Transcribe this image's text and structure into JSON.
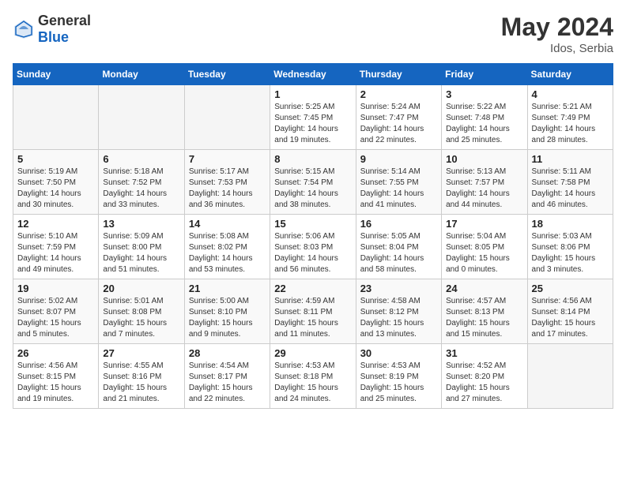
{
  "header": {
    "logo_general": "General",
    "logo_blue": "Blue",
    "month_year": "May 2024",
    "location": "Idos, Serbia"
  },
  "days_of_week": [
    "Sunday",
    "Monday",
    "Tuesday",
    "Wednesday",
    "Thursday",
    "Friday",
    "Saturday"
  ],
  "weeks": [
    [
      {
        "day": "",
        "info": ""
      },
      {
        "day": "",
        "info": ""
      },
      {
        "day": "",
        "info": ""
      },
      {
        "day": "1",
        "info": "Sunrise: 5:25 AM\nSunset: 7:45 PM\nDaylight: 14 hours\nand 19 minutes."
      },
      {
        "day": "2",
        "info": "Sunrise: 5:24 AM\nSunset: 7:47 PM\nDaylight: 14 hours\nand 22 minutes."
      },
      {
        "day": "3",
        "info": "Sunrise: 5:22 AM\nSunset: 7:48 PM\nDaylight: 14 hours\nand 25 minutes."
      },
      {
        "day": "4",
        "info": "Sunrise: 5:21 AM\nSunset: 7:49 PM\nDaylight: 14 hours\nand 28 minutes."
      }
    ],
    [
      {
        "day": "5",
        "info": "Sunrise: 5:19 AM\nSunset: 7:50 PM\nDaylight: 14 hours\nand 30 minutes."
      },
      {
        "day": "6",
        "info": "Sunrise: 5:18 AM\nSunset: 7:52 PM\nDaylight: 14 hours\nand 33 minutes."
      },
      {
        "day": "7",
        "info": "Sunrise: 5:17 AM\nSunset: 7:53 PM\nDaylight: 14 hours\nand 36 minutes."
      },
      {
        "day": "8",
        "info": "Sunrise: 5:15 AM\nSunset: 7:54 PM\nDaylight: 14 hours\nand 38 minutes."
      },
      {
        "day": "9",
        "info": "Sunrise: 5:14 AM\nSunset: 7:55 PM\nDaylight: 14 hours\nand 41 minutes."
      },
      {
        "day": "10",
        "info": "Sunrise: 5:13 AM\nSunset: 7:57 PM\nDaylight: 14 hours\nand 44 minutes."
      },
      {
        "day": "11",
        "info": "Sunrise: 5:11 AM\nSunset: 7:58 PM\nDaylight: 14 hours\nand 46 minutes."
      }
    ],
    [
      {
        "day": "12",
        "info": "Sunrise: 5:10 AM\nSunset: 7:59 PM\nDaylight: 14 hours\nand 49 minutes."
      },
      {
        "day": "13",
        "info": "Sunrise: 5:09 AM\nSunset: 8:00 PM\nDaylight: 14 hours\nand 51 minutes."
      },
      {
        "day": "14",
        "info": "Sunrise: 5:08 AM\nSunset: 8:02 PM\nDaylight: 14 hours\nand 53 minutes."
      },
      {
        "day": "15",
        "info": "Sunrise: 5:06 AM\nSunset: 8:03 PM\nDaylight: 14 hours\nand 56 minutes."
      },
      {
        "day": "16",
        "info": "Sunrise: 5:05 AM\nSunset: 8:04 PM\nDaylight: 14 hours\nand 58 minutes."
      },
      {
        "day": "17",
        "info": "Sunrise: 5:04 AM\nSunset: 8:05 PM\nDaylight: 15 hours\nand 0 minutes."
      },
      {
        "day": "18",
        "info": "Sunrise: 5:03 AM\nSunset: 8:06 PM\nDaylight: 15 hours\nand 3 minutes."
      }
    ],
    [
      {
        "day": "19",
        "info": "Sunrise: 5:02 AM\nSunset: 8:07 PM\nDaylight: 15 hours\nand 5 minutes."
      },
      {
        "day": "20",
        "info": "Sunrise: 5:01 AM\nSunset: 8:08 PM\nDaylight: 15 hours\nand 7 minutes."
      },
      {
        "day": "21",
        "info": "Sunrise: 5:00 AM\nSunset: 8:10 PM\nDaylight: 15 hours\nand 9 minutes."
      },
      {
        "day": "22",
        "info": "Sunrise: 4:59 AM\nSunset: 8:11 PM\nDaylight: 15 hours\nand 11 minutes."
      },
      {
        "day": "23",
        "info": "Sunrise: 4:58 AM\nSunset: 8:12 PM\nDaylight: 15 hours\nand 13 minutes."
      },
      {
        "day": "24",
        "info": "Sunrise: 4:57 AM\nSunset: 8:13 PM\nDaylight: 15 hours\nand 15 minutes."
      },
      {
        "day": "25",
        "info": "Sunrise: 4:56 AM\nSunset: 8:14 PM\nDaylight: 15 hours\nand 17 minutes."
      }
    ],
    [
      {
        "day": "26",
        "info": "Sunrise: 4:56 AM\nSunset: 8:15 PM\nDaylight: 15 hours\nand 19 minutes."
      },
      {
        "day": "27",
        "info": "Sunrise: 4:55 AM\nSunset: 8:16 PM\nDaylight: 15 hours\nand 21 minutes."
      },
      {
        "day": "28",
        "info": "Sunrise: 4:54 AM\nSunset: 8:17 PM\nDaylight: 15 hours\nand 22 minutes."
      },
      {
        "day": "29",
        "info": "Sunrise: 4:53 AM\nSunset: 8:18 PM\nDaylight: 15 hours\nand 24 minutes."
      },
      {
        "day": "30",
        "info": "Sunrise: 4:53 AM\nSunset: 8:19 PM\nDaylight: 15 hours\nand 25 minutes."
      },
      {
        "day": "31",
        "info": "Sunrise: 4:52 AM\nSunset: 8:20 PM\nDaylight: 15 hours\nand 27 minutes."
      },
      {
        "day": "",
        "info": ""
      }
    ]
  ]
}
